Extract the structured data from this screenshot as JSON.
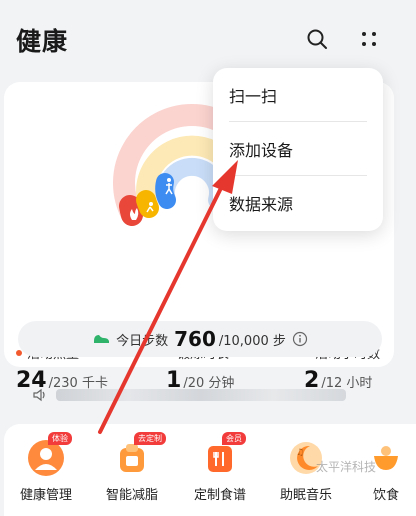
{
  "header": {
    "title": "健康"
  },
  "activity": {
    "metrics": [
      {
        "label": "活动热量",
        "value": "24",
        "target": "/230 千卡",
        "color": "#f25a2e"
      },
      {
        "label": "锻炼时长",
        "value": "1",
        "target": "/20 分钟",
        "color": "#f7b500"
      },
      {
        "label": "活动小时数",
        "value": "2",
        "target": "/12 小时",
        "color": "#3d8cf2"
      }
    ],
    "steps": {
      "label": "今日步数",
      "value": "760",
      "target": "/10,000 步"
    }
  },
  "services": [
    {
      "label": "健康管理",
      "badge": "体验"
    },
    {
      "label": "智能减脂",
      "badge": "去定制"
    },
    {
      "label": "定制食谱",
      "badge": "会员"
    },
    {
      "label": "助眠音乐",
      "badge": ""
    },
    {
      "label": "饮食",
      "badge": ""
    }
  ],
  "menu": {
    "items": [
      "扫一扫",
      "添加设备",
      "数据来源"
    ]
  },
  "watermark": "太平洋科技",
  "colors": {
    "accent_red": "#e8473a",
    "ring_red": "#e8473a",
    "ring_yellow": "#f7b500",
    "ring_blue": "#3d8cf2"
  },
  "icons": [
    "search-icon",
    "more-icon",
    "speaker-icon",
    "info-icon",
    "shoe-icon",
    "fire-icon",
    "run-icon",
    "walk-icon"
  ]
}
